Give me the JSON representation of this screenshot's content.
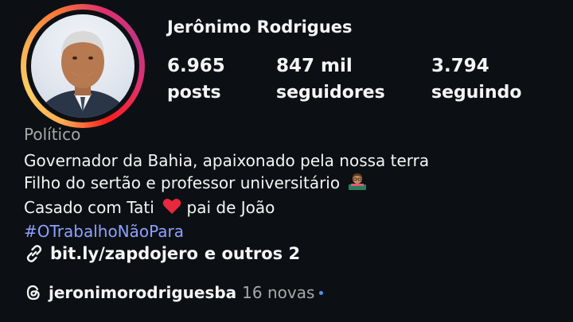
{
  "profile": {
    "username": "Jerônimo Rodrigues",
    "avatar_icon": "profile-photo",
    "story_ring_colors": [
      "#fbad50",
      "#f77737",
      "#e1306c",
      "#c13584"
    ],
    "stats": [
      {
        "value": "6.965",
        "label": "posts"
      },
      {
        "value": "847 mil",
        "label": "seguidores"
      },
      {
        "value": "3.794",
        "label": "seguindo"
      }
    ],
    "category": "Político",
    "bio": {
      "line1": "Governador da Bahia, apaixonado pela nossa terra",
      "line2": "Filho do sertão e professor universitário",
      "line2_emoji": "teacher-emoji",
      "line3_a": "Casado com Tati",
      "line3_emoji": "red-heart-emoji",
      "line3_b": "pai de João",
      "hashtag": "#OTrabalhoNãoPara"
    },
    "link": {
      "icon": "link-icon",
      "url": "bit.ly/zapdojero",
      "extra": "e outros 2"
    },
    "threads": {
      "icon": "threads-icon",
      "handle": "jeronimorodriguesba",
      "new_count": "16 novas",
      "dot_color": "#5b8def"
    }
  }
}
